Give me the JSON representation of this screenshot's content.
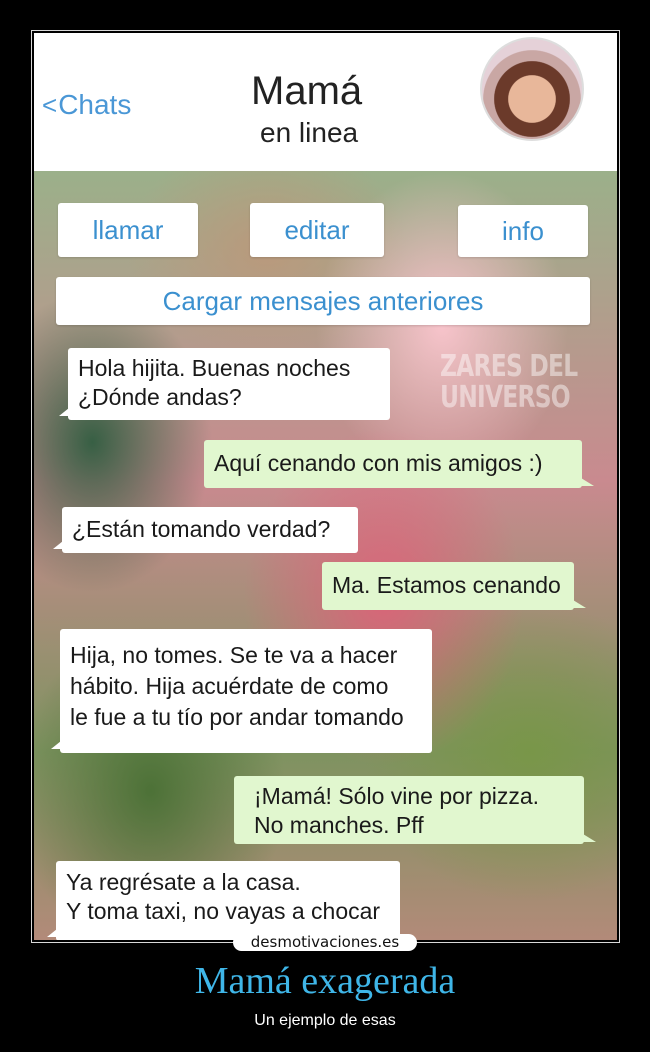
{
  "header": {
    "back_label": "Chats",
    "back_chevron": "<",
    "contact_name": "Mamá",
    "contact_status": "en linea",
    "avatar_icon": "contact-avatar"
  },
  "actions": {
    "call_label": "llamar",
    "edit_label": "editar",
    "info_label": "info",
    "load_earlier_label": "Cargar mensajes anteriores"
  },
  "watermark": {
    "line1": "ZARES DEL",
    "line2": "UNIVERSO"
  },
  "messages": [
    {
      "from": "incoming",
      "lines": [
        "Hola hijita. Buenas noches",
        "¿Dónde andas?"
      ]
    },
    {
      "from": "outgoing",
      "lines": [
        "Aquí cenando con mis amigos :)"
      ]
    },
    {
      "from": "incoming",
      "lines": [
        "¿Están tomando verdad?"
      ]
    },
    {
      "from": "outgoing",
      "lines": [
        "Ma. Estamos cenando"
      ]
    },
    {
      "from": "incoming",
      "lines": [
        "Hija, no tomes. Se te va a hacer",
        "hábito. Hija acuérdate de como",
        "le fue a tu tío por andar tomando"
      ]
    },
    {
      "from": "outgoing",
      "lines": [
        "¡Mamá! Sólo vine por pizza.",
        "No manches. Pff"
      ]
    },
    {
      "from": "incoming",
      "lines": [
        "Ya regrésate a la casa.",
        "Y toma taxi, no vayas a chocar"
      ]
    }
  ],
  "colors": {
    "accent": "#3b90cf",
    "incoming_bubble": "#ffffff",
    "outgoing_bubble": "#e1f7cf",
    "caption": "#3fb6e8"
  },
  "poster": {
    "site": "desmotivaciones.es",
    "title": "Mamá exagerada",
    "subtitle": "Un ejemplo de esas"
  }
}
